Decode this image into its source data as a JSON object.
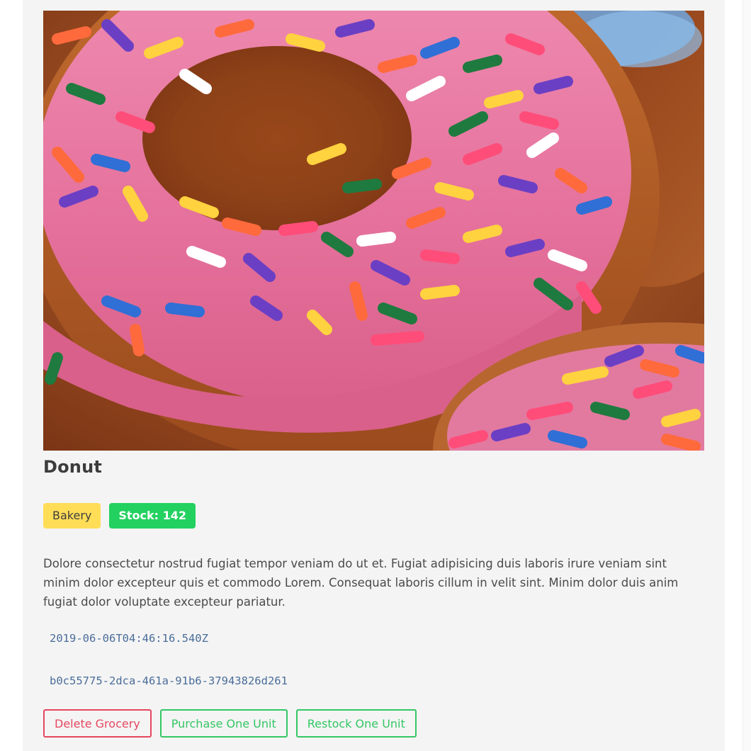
{
  "product": {
    "name": "Donut",
    "category": "Bakery",
    "stock_label": "Stock: 142",
    "description": "Dolore consectetur nostrud fugiat tempor veniam do ut et. Fugiat adipisicing duis laboris irure veniam sint minim dolor excepteur quis et commodo Lorem. Consequat laboris cillum in velit sint. Minim dolor duis anim fugiat dolor voluptate excepteur pariatur.",
    "created_at": "2019-06-06T04:46:16.540Z",
    "id": "b0c55775-2dca-461a-91b6-37943826d261"
  },
  "actions": {
    "delete_label": "Delete Grocery",
    "purchase_label": "Purchase One Unit",
    "restock_label": "Restock One Unit"
  },
  "colors": {
    "card_background": "#f4f4f4",
    "category_tag": "#ffdd57",
    "stock_tag": "#23d160",
    "danger": "#e6475f",
    "success": "#33c764",
    "mono_text": "#4a6d99",
    "frosting": "#e0739a",
    "dough": "#b5612a"
  },
  "icons": {
    "hero_image": "donut-photo"
  }
}
